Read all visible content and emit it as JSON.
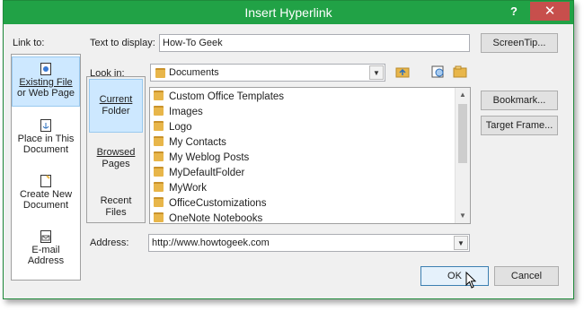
{
  "dialog": {
    "title": "Insert Hyperlink",
    "help": "?",
    "close": "✕"
  },
  "link_to": {
    "label": "Link to:",
    "items": [
      {
        "line1": "Existing File",
        "line2": "or Web Page",
        "selected": true
      },
      {
        "line1": "Place in This",
        "line2": "Document"
      },
      {
        "line1": "Create New",
        "line2": "Document"
      },
      {
        "line1": "E-mail",
        "line2": "Address"
      }
    ]
  },
  "text_to_display": {
    "label": "Text to display:",
    "value": "How-To Geek"
  },
  "screentip_button": "ScreenTip...",
  "look_in": {
    "label": "Look in:",
    "value": "Documents"
  },
  "nav": {
    "items": [
      {
        "line1": "Current",
        "line2": "Folder",
        "selected": true
      },
      {
        "line1": "Browsed",
        "line2": "Pages"
      },
      {
        "line1": "Recent",
        "line2": "Files"
      }
    ]
  },
  "files": [
    "Custom Office Templates",
    "Images",
    "Logo",
    "My Contacts",
    "My Weblog Posts",
    "MyDefaultFolder",
    "MyWork",
    "OfficeCustomizations",
    "OneNote Notebooks"
  ],
  "bookmark_button": "Bookmark...",
  "target_frame_button": "Target Frame...",
  "address": {
    "label": "Address:",
    "value": "http://www.howtogeek.com"
  },
  "ok_button": "OK",
  "cancel_button": "Cancel",
  "colors": {
    "titlebar": "#21a246",
    "close": "#c74f4c",
    "selection": "#cde8ff"
  },
  "icons": {
    "existing_file": "web-page-icon",
    "place_in_document": "document-anchor-icon",
    "create_new": "new-document-icon",
    "email": "email-icon",
    "look_in_folder": "folder-icon",
    "up_folder": "up-folder-icon",
    "browse_web": "browse-web-icon",
    "browse_file": "browse-file-icon"
  }
}
